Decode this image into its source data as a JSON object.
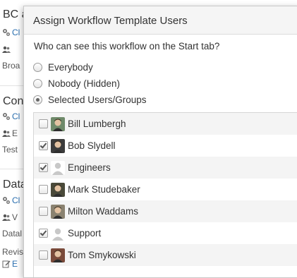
{
  "background": {
    "sections": [
      {
        "title": "BC a",
        "link": "Cl",
        "user": "",
        "desc": "Broa"
      },
      {
        "title": "Con",
        "link": "Cl",
        "user": "E",
        "desc": "Test"
      },
      {
        "title": "Data",
        "link": "Cl",
        "user": "V",
        "desc": "Datal",
        "extra": "Revis",
        "extra_link": "E"
      }
    ]
  },
  "dialog": {
    "title": "Assign Workflow Template Users",
    "question": "Who can see this workflow on the Start tab?",
    "options": [
      {
        "label": "Everybody",
        "selected": false
      },
      {
        "label": "Nobody (Hidden)",
        "selected": false
      },
      {
        "label": "Selected Users/Groups",
        "selected": true
      }
    ],
    "members": [
      {
        "name": "Bill Lumbergh",
        "checked": false,
        "avatar": "person-photo",
        "tone": "#6f8a6a"
      },
      {
        "name": "Bob Slydell",
        "checked": true,
        "avatar": "person-photo",
        "tone": "#3c3c3c"
      },
      {
        "name": "Engineers",
        "checked": true,
        "avatar": "group-silhouette",
        "tone": "#c8c8c8"
      },
      {
        "name": "Mark Studebaker",
        "checked": false,
        "avatar": "person-photo",
        "tone": "#4a4a3a"
      },
      {
        "name": "Milton Waddams",
        "checked": false,
        "avatar": "person-photo",
        "tone": "#8a8270"
      },
      {
        "name": "Support",
        "checked": true,
        "avatar": "group-silhouette",
        "tone": "#c8c8c8"
      },
      {
        "name": "Tom Smykowski",
        "checked": false,
        "avatar": "person-photo",
        "tone": "#7a4a3a"
      }
    ]
  }
}
